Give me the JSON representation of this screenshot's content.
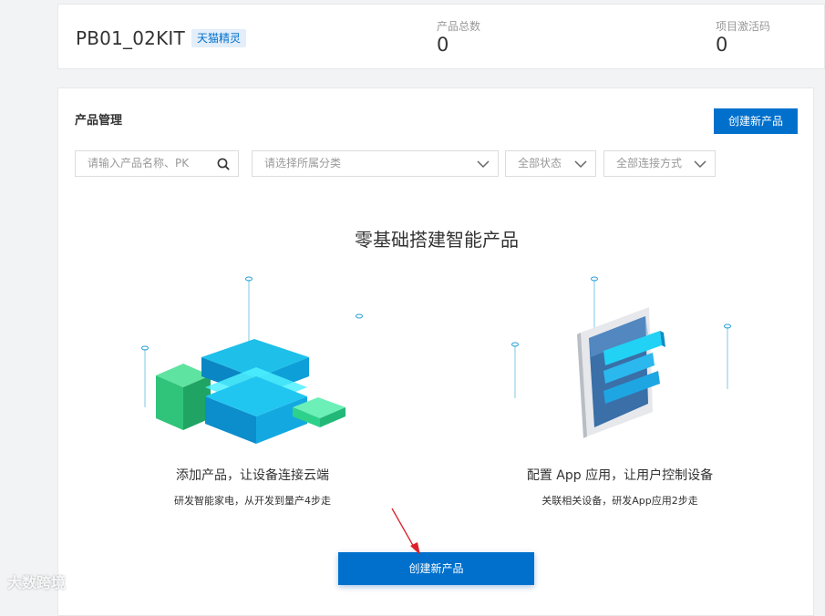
{
  "header": {
    "project_name": "PB01_02KIT",
    "badge": "天猫精灵",
    "stats": [
      {
        "label": "产品总数",
        "value": "0"
      },
      {
        "label": "项目激活码",
        "value": "0"
      }
    ]
  },
  "products": {
    "section_title": "产品管理",
    "create_button": "创建新产品",
    "filters": {
      "search_placeholder": "请输入产品名称、PK",
      "category_placeholder": "请选择所属分类",
      "status": "全部状态",
      "connection": "全部连接方式"
    },
    "empty_state": {
      "title": "零基础搭建智能产品",
      "features": [
        {
          "title": "添加产品，让设备连接云端",
          "desc": "研发智能家电，从开发到量产4步走"
        },
        {
          "title": "配置 App 应用，让用户控制设备",
          "desc": "关联相关设备，研发App应用2步走"
        }
      ],
      "create_button": "创建新产品"
    }
  },
  "watermark": "大数跨境",
  "colors": {
    "primary": "#0070cc",
    "badge_bg": "#e3eefa",
    "arrow": "#d9222a"
  }
}
